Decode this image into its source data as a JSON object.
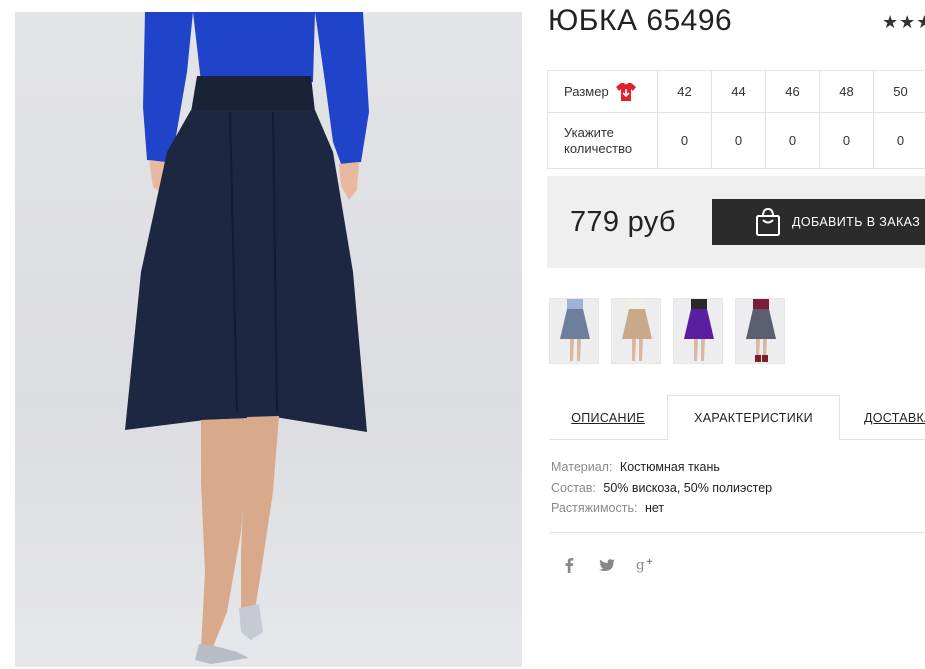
{
  "product": {
    "title": "ЮБКА 65496",
    "rating_stars": "★★★"
  },
  "size_table": {
    "size_label": "Размер",
    "sizes": [
      "42",
      "44",
      "46",
      "48",
      "50"
    ],
    "quantity_label": "Укажите количество",
    "quantities": [
      "0",
      "0",
      "0",
      "0",
      "0"
    ]
  },
  "purchase": {
    "price": "779 руб",
    "add_button_label": "ДОБАВИТЬ В ЗАКАЗ"
  },
  "thumbnails": [
    {
      "color": "#6e7f9c"
    },
    {
      "color": "#c9a98a"
    },
    {
      "color": "#5a1fa0"
    },
    {
      "color": "#5a5e6e"
    }
  ],
  "tabs": {
    "description": "ОПИСАНИЕ",
    "characteristics": "ХАРАКТЕРИСТИКИ",
    "delivery": "ДОСТАВКА"
  },
  "specs": [
    {
      "key": "Материал:",
      "value": "Костюмная ткань"
    },
    {
      "key": "Состав:",
      "value": "50% вискоза, 50% полиэстер"
    },
    {
      "key": "Растяжимость:",
      "value": "нет"
    }
  ],
  "social": [
    "facebook-icon",
    "twitter-icon",
    "google-plus-icon"
  ],
  "colors": {
    "button_bg": "#2b2b2b",
    "price_panel_bg": "#efefef",
    "skirt": "#1d2742",
    "top": "#1f44c9",
    "accent_icon": "#e3202a"
  }
}
